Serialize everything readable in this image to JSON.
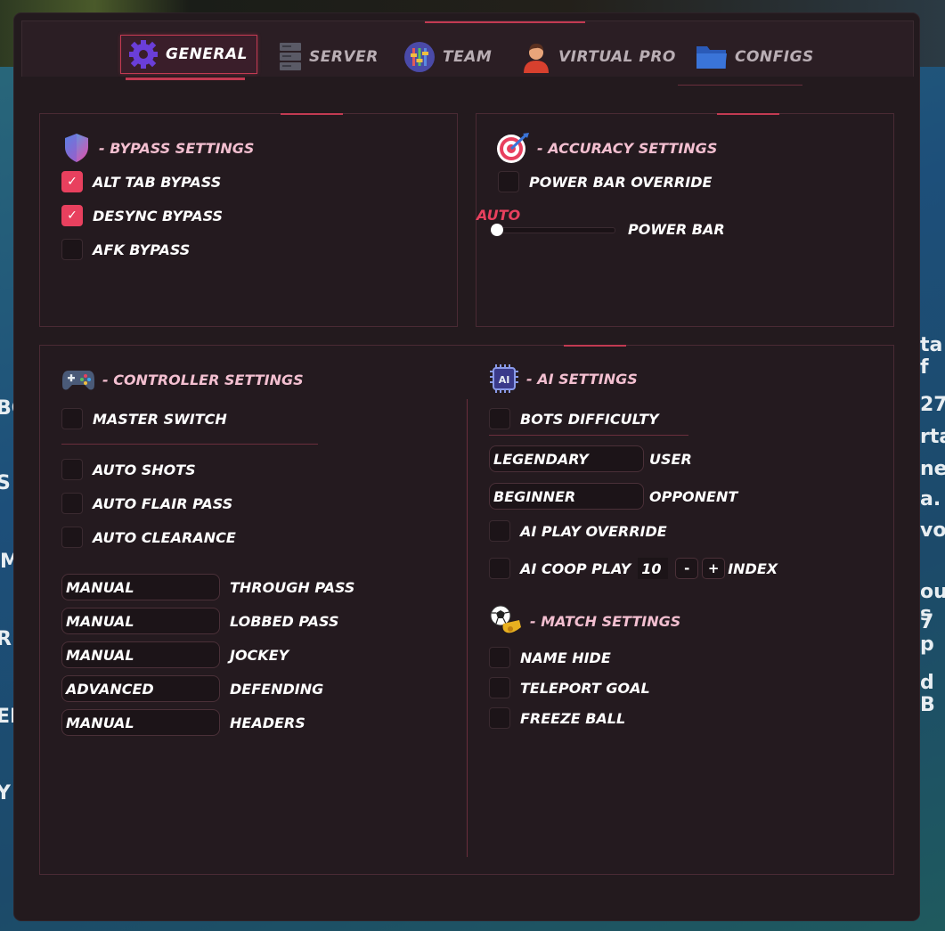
{
  "background": {
    "side_text": [
      "ta f",
      "27",
      "rta,",
      "ner",
      "a.",
      "vo",
      "ou s",
      "7 p",
      "d B"
    ],
    "left_text": [
      "BC",
      "S",
      "M",
      "RI",
      "EF",
      "Y"
    ]
  },
  "tabs": [
    {
      "label": "GENERAL",
      "icon": "gear-icon",
      "active": true
    },
    {
      "label": "SERVER",
      "icon": "server-icon",
      "active": false
    },
    {
      "label": "TEAM",
      "icon": "team-icon",
      "active": false
    },
    {
      "label": "VIRTUAL PRO",
      "icon": "player-icon",
      "active": false
    },
    {
      "label": "CONFIGS",
      "icon": "folder-icon",
      "active": false
    }
  ],
  "bypass": {
    "title": "- BYPASS SETTINGS",
    "items": [
      {
        "label": "ALT TAB BYPASS",
        "checked": true
      },
      {
        "label": "DESYNC BYPASS",
        "checked": true
      },
      {
        "label": "AFK BYPASS",
        "checked": false
      }
    ]
  },
  "accuracy": {
    "title": "- ACCURACY SETTINGS",
    "override_label": "POWER BAR OVERRIDE",
    "slider_value_label": "AUTO",
    "slider_label": "POWER BAR",
    "slider_value": 0
  },
  "controller": {
    "title": "- CONTROLLER SETTINGS",
    "master_label": "MASTER SWITCH",
    "items": [
      {
        "label": "AUTO SHOTS"
      },
      {
        "label": "AUTO FLAIR PASS"
      },
      {
        "label": "AUTO CLEARANCE"
      }
    ],
    "dropdowns": [
      {
        "value": "MANUAL",
        "label": "THROUGH PASS"
      },
      {
        "value": "MANUAL",
        "label": "LOBBED PASS"
      },
      {
        "value": "MANUAL",
        "label": "JOCKEY"
      },
      {
        "value": "ADVANCED",
        "label": "DEFENDING"
      },
      {
        "value": "MANUAL",
        "label": "HEADERS"
      }
    ]
  },
  "ai": {
    "title": "- AI SETTINGS",
    "chip_text": "AI",
    "bots_label": "BOTS DIFFICULTY",
    "dropdowns": [
      {
        "value": "LEGENDARY",
        "label": "USER"
      },
      {
        "value": "BEGINNER",
        "label": "OPPONENT"
      }
    ],
    "play_override_label": "AI PLAY OVERRIDE",
    "coop_label": "AI COOP PLAY",
    "coop_value": "10",
    "minus": "-",
    "plus": "+",
    "index_label": "INDEX"
  },
  "match": {
    "title": "- MATCH SETTINGS",
    "items": [
      {
        "label": "NAME HIDE"
      },
      {
        "label": "TELEPORT GOAL"
      },
      {
        "label": "FREEZE BALL"
      }
    ]
  },
  "colors": {
    "accent": "#e8405e",
    "panel_bg": "#241a1f",
    "title_pink": "#f3bfd0",
    "border": "#4a2a34"
  }
}
